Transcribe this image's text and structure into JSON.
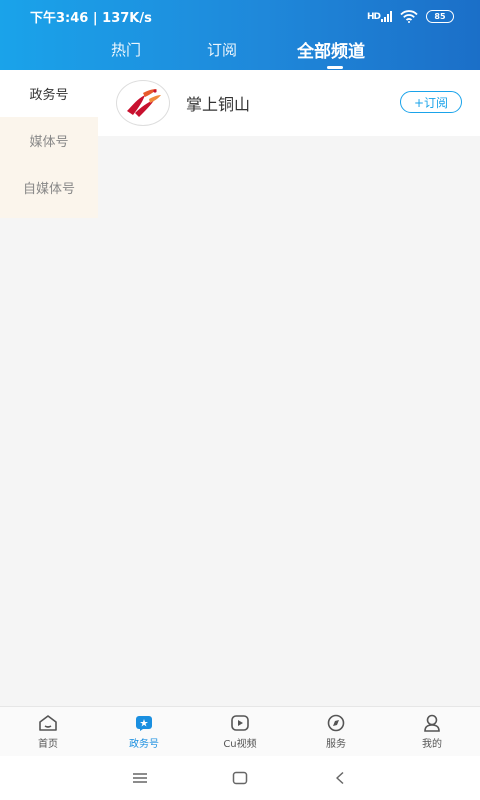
{
  "status_bar": {
    "time": "下午3:46",
    "speed": "137K/s",
    "network": "HD",
    "battery": "85"
  },
  "tabs": [
    {
      "label": "热门",
      "active": false
    },
    {
      "label": "订阅",
      "active": false
    },
    {
      "label": "全部频道",
      "active": true
    }
  ],
  "sidebar": {
    "items": [
      {
        "label": "政务号",
        "active": true
      },
      {
        "label": "媒体号",
        "active": false
      },
      {
        "label": "自媒体号",
        "active": false
      }
    ]
  },
  "channels": [
    {
      "name": "掌上铜山",
      "subscribe_label": "+订阅"
    }
  ],
  "bottom_nav": [
    {
      "label": "首页",
      "icon": "home-icon",
      "active": false
    },
    {
      "label": "政务号",
      "icon": "gov-account-icon",
      "active": true
    },
    {
      "label": "Cu视频",
      "icon": "video-play-icon",
      "active": false
    },
    {
      "label": "服务",
      "icon": "compass-icon",
      "active": false
    },
    {
      "label": "我的",
      "icon": "profile-icon",
      "active": false
    }
  ],
  "colors": {
    "accent": "#1aa3ea",
    "active_nav": "#1a8fe0",
    "sidebar_bg": "#fbf5ec"
  }
}
